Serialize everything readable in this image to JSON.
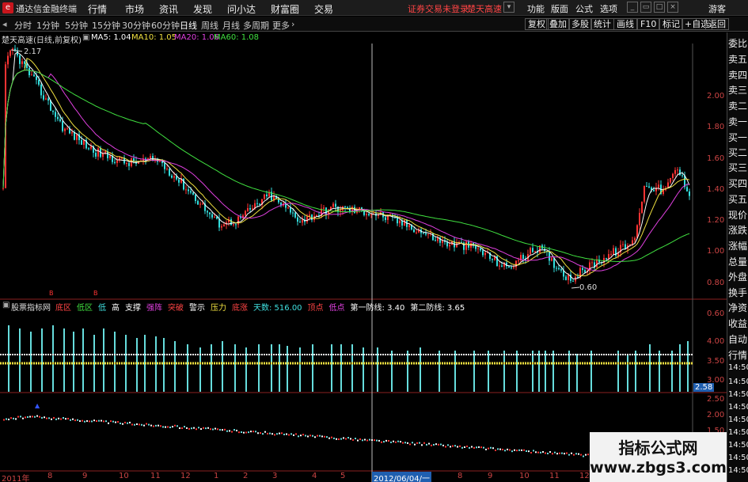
{
  "menubar": {
    "logo": "e",
    "app_title": "通达信金融终端",
    "items": [
      "行情",
      "市场",
      "资讯",
      "发现",
      "问小达",
      "财富圈",
      "交易"
    ],
    "alert1": "证券交易未登录",
    "alert2": "楚天高速",
    "right_items": [
      "功能",
      "版面",
      "公式",
      "选项"
    ],
    "guest": "游客"
  },
  "toolbar": {
    "tabs": [
      "分时",
      "1分钟",
      "5分钟",
      "15分钟",
      "30分钟",
      "60分钟",
      "日线",
      "周线",
      "月线",
      "多周期",
      "更多"
    ],
    "active_tab": "日线",
    "right_buttons": [
      "复权",
      "叠加",
      "多股",
      "统计",
      "画线",
      "F10",
      "标记",
      "+自选",
      "返回"
    ]
  },
  "main_chart": {
    "stock_label": "楚天高速(日线,前复权)",
    "ma": [
      {
        "label": "MA5: 1.04",
        "color": "#ffffff"
      },
      {
        "label": "MA10: 1.05",
        "color": "#f0e040"
      },
      {
        "label": "MA20: 1.06",
        "color": "#e040e0"
      },
      {
        "label": "MA60: 1.08",
        "color": "#40e040"
      }
    ],
    "high_label": "2.17",
    "low_label": "0.60",
    "y_ticks": [
      "2.00",
      "1.80",
      "1.60",
      "1.40",
      "1.20",
      "1.00",
      "0.80",
      "0.60"
    ]
  },
  "indicator": {
    "title": "股票指标网",
    "legend": [
      {
        "label": "底区",
        "color": "#ff4444"
      },
      {
        "label": "低区",
        "color": "#40e040"
      },
      {
        "label": "低",
        "color": "#40e0e0"
      },
      {
        "label": "高",
        "color": "#ffffff"
      },
      {
        "label": "支撑",
        "color": "#ffffff"
      },
      {
        "label": "强阵",
        "color": "#e040e0"
      },
      {
        "label": "突破",
        "color": "#ff4444"
      },
      {
        "label": "警示",
        "color": "#ffffff"
      },
      {
        "label": "压力",
        "color": "#f0e040"
      },
      {
        "label": "底涨",
        "color": "#ff4444"
      },
      {
        "label": "天数: 516.00",
        "color": "#40e0e0"
      },
      {
        "label": "顶点",
        "color": "#ff4444"
      },
      {
        "label": "低点",
        "color": "#e040e0"
      },
      {
        "label": "第一防线: 3.40",
        "color": "#ffffff"
      },
      {
        "label": "第二防线: 3.65",
        "color": "#ffffff"
      }
    ],
    "y_ticks": [
      "4.00",
      "3.50",
      "3.00"
    ],
    "badge": "2.58"
  },
  "lower_chart": {
    "y_ticks": [
      "2.50",
      "2.00",
      "1.50"
    ]
  },
  "x_axis": {
    "labels": [
      "2011年",
      "8",
      "9",
      "10",
      "11",
      "12",
      "1",
      "2",
      "3",
      "4",
      "5",
      "2012/06/04/一",
      "8",
      "9",
      "10",
      "11",
      "12"
    ]
  },
  "sidebar": {
    "items": [
      "委比",
      "卖五",
      "卖四",
      "卖三",
      "卖二",
      "卖一",
      "买一",
      "买二",
      "买三",
      "买四",
      "买五",
      "现价",
      "涨跌",
      "涨幅",
      "总量",
      "外盘",
      "换手",
      "净资",
      "收益",
      "自动",
      "行情",
      "14:50",
      "14:50",
      "14:50",
      "14:50",
      "14:50",
      "14:50",
      "14:50",
      "14:50",
      "14:50"
    ]
  },
  "watermark": {
    "line1": "指标公式网",
    "line2": "www.zbgs3.com"
  }
}
